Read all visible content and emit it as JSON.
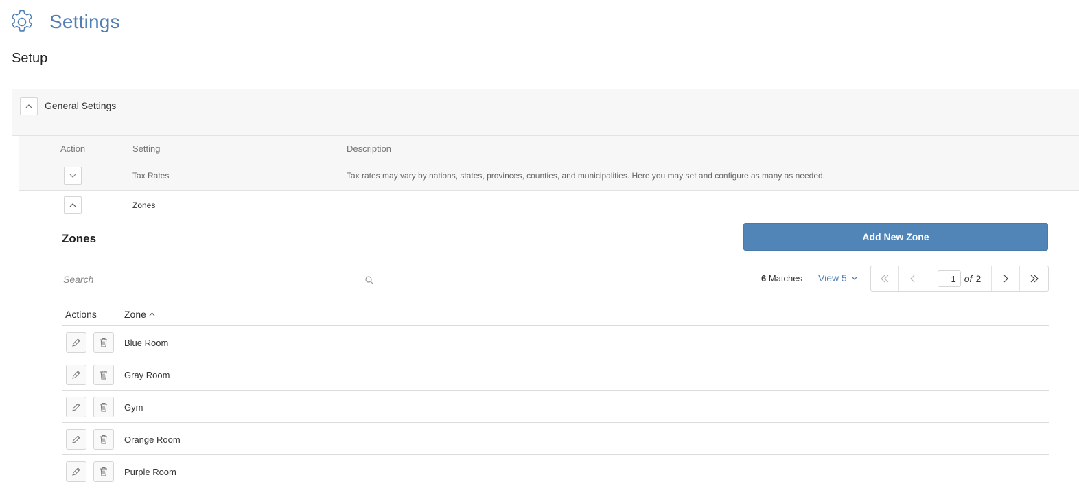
{
  "header": {
    "title": "Settings",
    "subtitle": "Setup",
    "icon": "gear-icon",
    "accent_color": "#4f7fb3"
  },
  "general_settings": {
    "title": "General Settings",
    "expanded": true,
    "columns": {
      "action": "Action",
      "setting": "Setting",
      "description": "Description"
    },
    "rows": [
      {
        "setting": "Tax Rates",
        "description": "Tax rates may vary by nations, states, provinces, counties, and municipalities. Here you may set and configure as many as needed.",
        "expanded": false
      },
      {
        "setting": "Zones",
        "description": "",
        "expanded": true
      }
    ]
  },
  "zones": {
    "heading": "Zones",
    "add_button": "Add New Zone",
    "add_button_color": "#5185b8",
    "search": {
      "placeholder": "Search",
      "value": ""
    },
    "matches_count": "6",
    "matches_label": "Matches",
    "view_label": "View 5",
    "pager": {
      "current_page": "1",
      "of_label": "of",
      "total_pages": "2"
    },
    "table": {
      "columns": {
        "actions": "Actions",
        "zone": "Zone"
      },
      "sort": "ascending",
      "rows": [
        {
          "name": "Blue Room"
        },
        {
          "name": "Gray Room"
        },
        {
          "name": "Gym"
        },
        {
          "name": "Orange Room"
        },
        {
          "name": "Purple Room"
        }
      ]
    }
  }
}
